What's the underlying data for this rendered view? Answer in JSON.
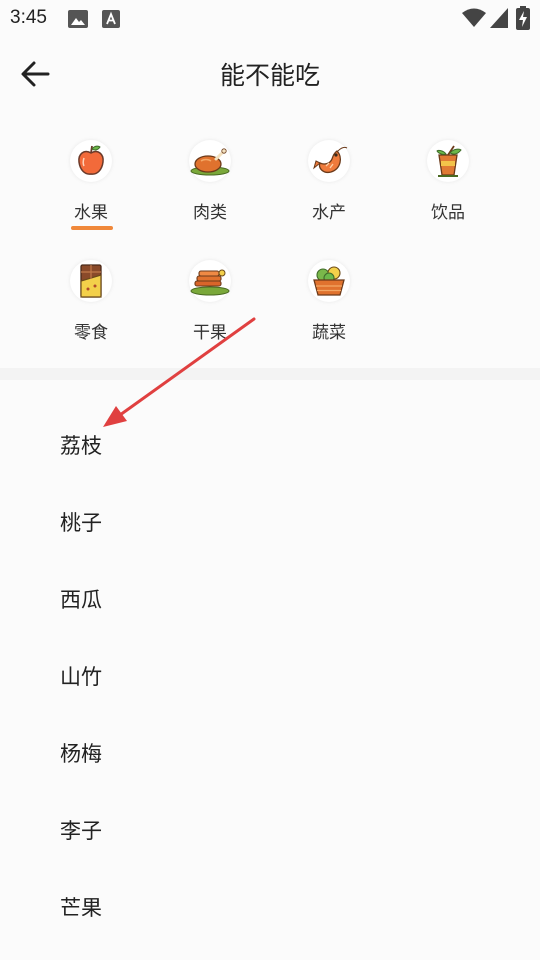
{
  "status_bar": {
    "time": "3:45",
    "icons": [
      "image-icon",
      "font-a-icon",
      "wifi-icon",
      "signal-icon",
      "battery-charging-icon"
    ]
  },
  "header": {
    "title": "能不能吃",
    "back_icon": "arrow-left-icon"
  },
  "categories": [
    {
      "label": "水果",
      "icon": "apple-icon",
      "selected": true
    },
    {
      "label": "肉类",
      "icon": "roast-chicken-icon",
      "selected": false
    },
    {
      "label": "水产",
      "icon": "shrimp-icon",
      "selected": false
    },
    {
      "label": "饮品",
      "icon": "drink-cup-icon",
      "selected": false
    },
    {
      "label": "零食",
      "icon": "chocolate-icon",
      "selected": false
    },
    {
      "label": "干果",
      "icon": "dried-fruit-icon",
      "selected": false
    },
    {
      "label": "蔬菜",
      "icon": "vegetable-basket-icon",
      "selected": false
    }
  ],
  "foods": [
    {
      "label": "荔枝"
    },
    {
      "label": "桃子"
    },
    {
      "label": "西瓜"
    },
    {
      "label": "山竹"
    },
    {
      "label": "杨梅"
    },
    {
      "label": "李子"
    },
    {
      "label": "芒果"
    }
  ],
  "colors": {
    "accent": "#f0883a",
    "annotation_arrow": "#e04040",
    "background": "#fbfbfb"
  }
}
